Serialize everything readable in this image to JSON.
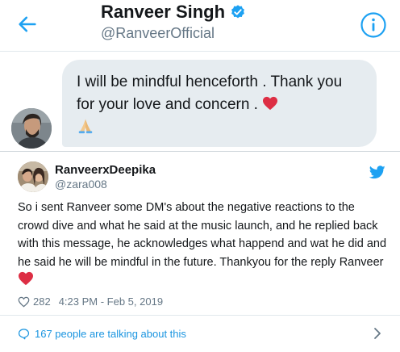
{
  "dm": {
    "header": {
      "name": "Ranveer Singh",
      "handle": "@RanveerOfficial",
      "icons": [
        "back-arrow-icon",
        "verified-badge-icon",
        "info-icon"
      ]
    },
    "message": {
      "text": "I will be mindful henceforth . Thank you for your love and concern . ",
      "emojis": [
        "red-heart",
        "folded-hands"
      ]
    }
  },
  "tweet": {
    "display_name": "RanveerxDeepika",
    "handle": "@zara008",
    "text": "So i sent Ranveer some DM's about the negative reactions to the crowd dive and what he said at the music launch, and he replied back with this message, he acknowledges what happend and wat he did and he said he will be mindful in the future. Thankyou for the reply Ranveer ",
    "likes": "282",
    "timestamp": "4:23 PM - Feb 5, 2019",
    "talking": "167 people are talking about this"
  },
  "colors": {
    "twitter_blue": "#1da1f2",
    "link_blue": "#1b95e0",
    "bubble_gray": "#e6ecf0",
    "secondary_text": "#657786",
    "heart_red": "#e0245e"
  }
}
